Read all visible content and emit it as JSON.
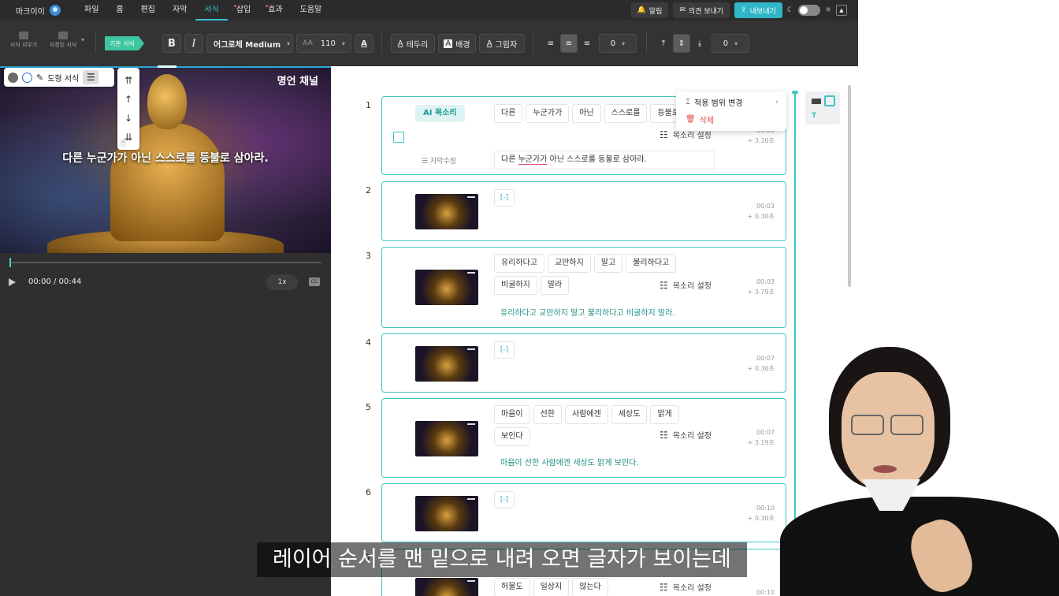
{
  "menubar": {
    "app_name": "마크이이",
    "items": [
      "파일",
      "홈",
      "편집",
      "자막",
      "서식",
      "삽입",
      "효과",
      "도움말"
    ],
    "active_item": "서식",
    "alarm": "알림",
    "feedback": "의견 보내기",
    "export": "내보내기",
    "accent_color": "#35c0d6"
  },
  "toolbar": {
    "clear_format": "서식 지우기",
    "saved_format": "지정된 서식",
    "basic_format": "기본 서식",
    "bold": "B",
    "italic": "I",
    "font_name": "어그로체 Medium",
    "font_size_icon": "AA",
    "font_size": "110",
    "font_color_icon": "A",
    "border": "테두리",
    "background": "배경",
    "shadow": "그림자",
    "spacing_value": "0",
    "line_spacing_value": "0"
  },
  "preview": {
    "channel_label": "명언 채널",
    "caption": "다른 누군가가 아닌 스스로를 등불로 삼아라.",
    "shape_format": "도형 서식",
    "time": "00:00 / 00:44",
    "speed": "1x",
    "cc": "CC"
  },
  "scenes": [
    {
      "number": "1",
      "ai_voice_label": "AI 목소리",
      "words": [
        "다른",
        "누군가가",
        "아닌",
        "스스로를",
        "등불로",
        "삼"
      ],
      "voice_setting": "목소리 설정",
      "time": "00:00",
      "duration": "+ 3.10초",
      "edit_label": "자막수정",
      "sentence_parts": [
        "다른 ",
        "누군가가",
        " 아닌 스스로를 등불로 삼아라."
      ]
    },
    {
      "number": "2",
      "bracket": "[-]",
      "time": "00:03",
      "duration": "+ 0.30초"
    },
    {
      "number": "3",
      "words": [
        "유리하다고",
        "교만하지",
        "말고",
        "불리하다고",
        "비굴하지",
        "말라"
      ],
      "voice_setting": "목소리 설정",
      "time": "00:03",
      "duration": "+ 3.79초",
      "sentence": "유리하다고 교만하지 말고 불리하다고 비굴하지 말라."
    },
    {
      "number": "4",
      "bracket": "[-]",
      "time": "00:07",
      "duration": "+ 0.30초"
    },
    {
      "number": "5",
      "words": [
        "마음이",
        "선한",
        "사람에겐",
        "세상도",
        "맑게",
        "보인다"
      ],
      "voice_setting": "목소리 설정",
      "time": "00:07",
      "duration": "+ 3.19초",
      "sentence": "마음이 선한 사람에겐 세상도 맑게 보인다."
    },
    {
      "number": "6",
      "bracket": "[-]",
      "time": "00:10",
      "duration": "+ 0.30초"
    },
    {
      "number": "7",
      "words": [
        "허물도",
        "일상지",
        "않는다"
      ],
      "voice_setting": "목소리 설정",
      "time": "00:10"
    }
  ],
  "context_menu": {
    "change_scope": "적용 범위 변경",
    "delete": "삭제",
    "delete_color": "#e04a4a"
  },
  "subtitle_overlay": "레이어 순서를 맨 밑으로 내려 오면 글자가 보이는데"
}
